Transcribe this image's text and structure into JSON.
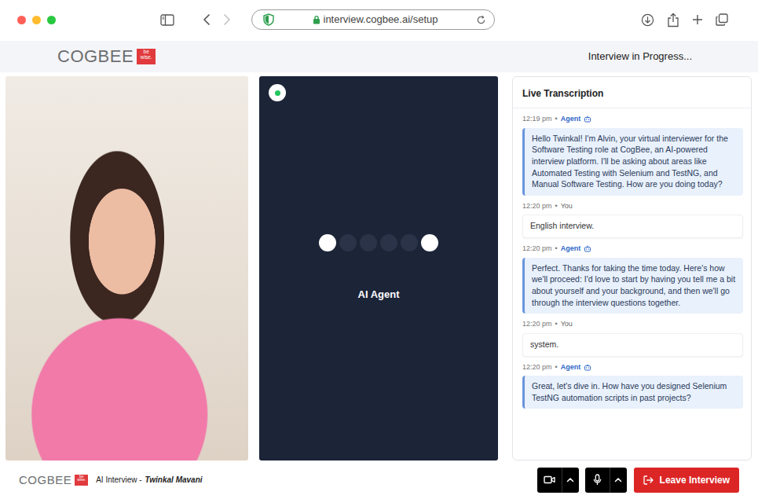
{
  "browser": {
    "url": "interview.cogbee.ai/setup",
    "nav": [
      {
        "kind": "back",
        "disabled": false
      },
      {
        "kind": "forward",
        "disabled": true
      }
    ]
  },
  "header": {
    "logo": "COGBEE",
    "logo_tag": "be wise.",
    "status": "Interview in Progress..."
  },
  "agent": {
    "label": "AI Agent",
    "active": true,
    "dots": [
      {
        "lit": true
      },
      {
        "lit": false
      },
      {
        "lit": false
      },
      {
        "lit": false
      },
      {
        "lit": false
      },
      {
        "lit": true
      }
    ]
  },
  "transcript": {
    "title": "Live Transcription",
    "messages": [
      {
        "time": "12:19 pm",
        "sep": "•",
        "speaker": "Agent",
        "kind": "agent",
        "text": "Hello Twinkal! I'm Alvin, your virtual interviewer for the Software Testing role at CogBee, an AI-powered interview platform. I'll be asking about areas like Automated Testing with Selenium and TestNG, and Manual Software Testing. How are you doing today?"
      },
      {
        "time": "12:20 pm",
        "sep": "•",
        "speaker": "You",
        "kind": "user",
        "text": "English interview."
      },
      {
        "time": "12:20 pm",
        "sep": "•",
        "speaker": "Agent",
        "kind": "agent",
        "text": "Perfect. Thanks for taking the time today. Here's how we'll proceed: I'd love to start by having you tell me a bit about yourself and your background, and then we'll go through the interview questions together."
      },
      {
        "time": "12:20 pm",
        "sep": "•",
        "speaker": "You",
        "kind": "user",
        "text": "system."
      },
      {
        "time": "12:20 pm",
        "sep": "•",
        "speaker": "Agent",
        "kind": "agent",
        "text": "Great, let's dive in. How have you designed Selenium TestNG automation scripts in past projects?"
      }
    ]
  },
  "footer": {
    "logo": "COGBEE",
    "logo_tag": "be wise.",
    "title": "AI Interview -",
    "candidate": "Twinkal Mavani",
    "controls": [
      {
        "kind": "camera"
      },
      {
        "kind": "mic"
      }
    ],
    "leave": "Leave Interview"
  }
}
